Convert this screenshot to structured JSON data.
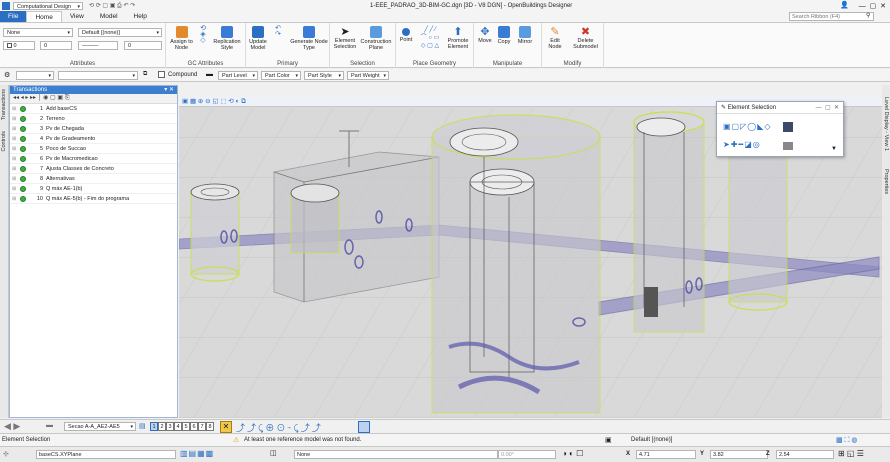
{
  "titlebar": {
    "workflow": "Computational Design",
    "title": "1-EEE_PADRAO_3D-BIM-GC.dgn [3D - V8 DGN] - OpenBuildings Designer"
  },
  "tabs": [
    "File",
    "Home",
    "View",
    "Model",
    "Help"
  ],
  "search": {
    "placeholder": "Search Ribbon (F4)"
  },
  "attributes": {
    "level": "None",
    "style": "Default [(none)]",
    "weight": "0",
    "transparency": "0",
    "label": "Attributes"
  },
  "groups": {
    "gc_attributes": {
      "label": "GC Attributes",
      "assign": "Assign to Node",
      "replication": "Replication Style"
    },
    "primary": {
      "label": "Primary",
      "update": "Update Model",
      "undo": "Undo",
      "generate": "Generate Node Type"
    },
    "selection": {
      "label": "Selection",
      "element": "Element Selection",
      "construction": "Construction Plane"
    },
    "place_geometry": {
      "label": "Place Geometry",
      "point": "Point",
      "promote": "Promote Element"
    },
    "manipulate": {
      "label": "Manipulate",
      "move": "Move",
      "copy": "Copy",
      "mirror": "Mirror"
    },
    "modify": {
      "label": "Modify",
      "edit": "Edit Node",
      "delete": "Delete Submodel"
    }
  },
  "toolrow": {
    "compound": "Compound",
    "part_level": "Part Level",
    "part_color": "Part Color",
    "part_style": "Part Style",
    "part_weight": "Part Weight"
  },
  "side_tabs": {
    "left1": "Transactions",
    "left2": "Controls",
    "right1": "Level Display - View 1",
    "right2": "Properties"
  },
  "transactions": {
    "title": "Transactions",
    "rows": [
      {
        "n": "1",
        "label": "Add baseCS"
      },
      {
        "n": "2",
        "label": "Terreno"
      },
      {
        "n": "3",
        "label": "Pv de Chegada"
      },
      {
        "n": "4",
        "label": "Pv de Gradeamento"
      },
      {
        "n": "5",
        "label": "Poco de Succao"
      },
      {
        "n": "6",
        "label": "Pv de Macromedicao"
      },
      {
        "n": "7",
        "label": "Ajusta Classes de Concreto"
      },
      {
        "n": "8",
        "label": "Alternativas"
      },
      {
        "n": "9",
        "label": "Q máx AE-1(b)"
      },
      {
        "n": "10",
        "label": "Q máx AE-5(b) - Fim do programa"
      }
    ]
  },
  "element_selection": {
    "title": "Element Selection"
  },
  "bottombar": {
    "saved_view": "Secao A-A_AE2-AE5",
    "views": [
      "1",
      "2",
      "3",
      "4",
      "5",
      "6",
      "7",
      "8"
    ]
  },
  "status": {
    "left": "Element Selection",
    "message": "At least one reference model was not found.",
    "default_model": "Default [(none)]"
  },
  "status2": {
    "acs": "baseCS.XYPlane",
    "level": "None",
    "angle": "0.00°",
    "x_label": "X",
    "x": "4.71",
    "y_label": "Y",
    "y": "3.82",
    "z_label": "Z",
    "z": "2.54"
  },
  "colors": {
    "accent": "#2b6fc2",
    "transaction_dot": "#3cb043",
    "selection_highlight": "#c8e04a",
    "viewport_bg": "#dcdcdc"
  }
}
